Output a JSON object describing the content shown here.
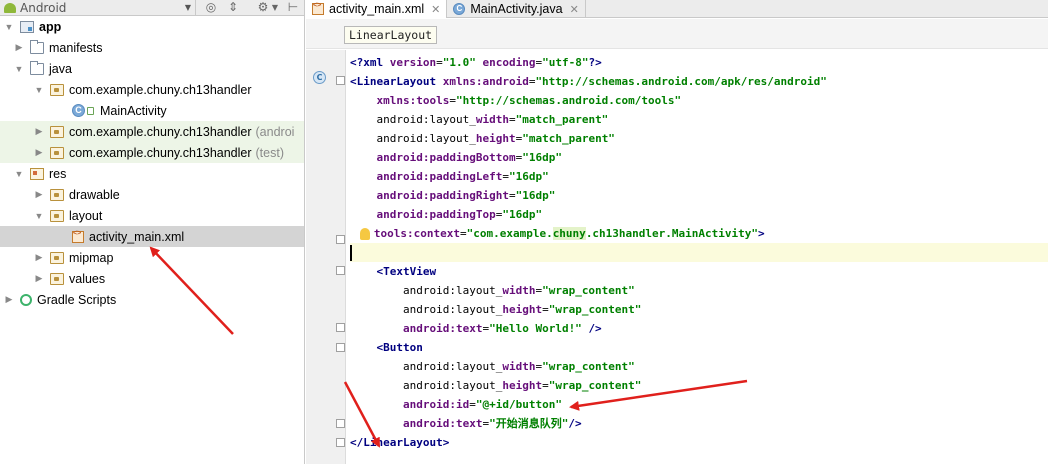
{
  "project_panel": {
    "view_mode": "Android",
    "tree": [
      {
        "label": "app",
        "bold": true,
        "icon": "app-module-icon",
        "indent": 0,
        "arrow": "▼"
      },
      {
        "label": "manifests",
        "icon": "folder-icon",
        "indent": 1,
        "arrow": "▶"
      },
      {
        "label": "java",
        "icon": "folder-icon",
        "indent": 1,
        "arrow": "▼"
      },
      {
        "label": "com.example.chuny.ch13handler",
        "icon": "package-icon",
        "indent": 2,
        "arrow": "▼"
      },
      {
        "label": "MainActivity",
        "icon": "class-icon",
        "indent": 3,
        "arrow": ""
      },
      {
        "label": "com.example.chuny.ch13handler",
        "suffix": "(androi",
        "icon": "package-icon",
        "indent": 2,
        "arrow": "▶"
      },
      {
        "label": "com.example.chuny.ch13handler",
        "suffix": "(test)",
        "icon": "package-icon",
        "indent": 2,
        "arrow": "▶"
      },
      {
        "label": "res",
        "icon": "res-folder-icon",
        "indent": 1,
        "arrow": "▼"
      },
      {
        "label": "drawable",
        "icon": "package-icon",
        "indent": 2,
        "arrow": "▶"
      },
      {
        "label": "layout",
        "icon": "package-icon",
        "indent": 2,
        "arrow": "▼"
      },
      {
        "label": "activity_main.xml",
        "icon": "xml-file-icon",
        "indent": 3,
        "arrow": ""
      },
      {
        "label": "mipmap",
        "icon": "package-icon",
        "indent": 2,
        "arrow": "▶"
      },
      {
        "label": "values",
        "icon": "package-icon",
        "indent": 2,
        "arrow": "▶"
      },
      {
        "label": "Gradle Scripts",
        "icon": "gradle-icon",
        "indent": 0,
        "arrow": "▶"
      }
    ]
  },
  "editor": {
    "tabs": [
      {
        "label": "activity_main.xml",
        "icon": "xml-file-icon",
        "active": true
      },
      {
        "label": "MainActivity.java",
        "icon": "class-icon",
        "active": false
      }
    ],
    "breadcrumb": "LinearLayout",
    "code": [
      "<?xml version=\"1.0\" encoding=\"utf-8\"?>",
      "<LinearLayout xmlns:android=\"http://schemas.android.com/apk/res/android\"",
      "    xmlns:tools=\"http://schemas.android.com/tools\"",
      "    android:layout_width=\"match_parent\"",
      "    android:layout_height=\"match_parent\"",
      "    android:paddingBottom=\"16dp\"",
      "    android:paddingLeft=\"16dp\"",
      "    android:paddingRight=\"16dp\"",
      "    android:paddingTop=\"16dp\"",
      "    tools:context=\"com.example.chuny.ch13handler.MainActivity\">",
      "",
      "    <TextView",
      "        android:layout_width=\"wrap_content\"",
      "        android:layout_height=\"wrap_content\"",
      "        android:text=\"Hello World!\" />",
      "    <Button",
      "        android:layout_width=\"wrap_content\"",
      "        android:layout_height=\"wrap_content\"",
      "        android:id=\"@+id/button\"",
      "        android:text=\"开始消息队列\"/>",
      "</LinearLayout>"
    ]
  },
  "colors": {
    "xml_tag": "#000080",
    "xml_attr": "#660e7a",
    "xml_value": "#008000",
    "annotation_arrow": "#e0201c",
    "selected_row": "#d4d4d4"
  }
}
